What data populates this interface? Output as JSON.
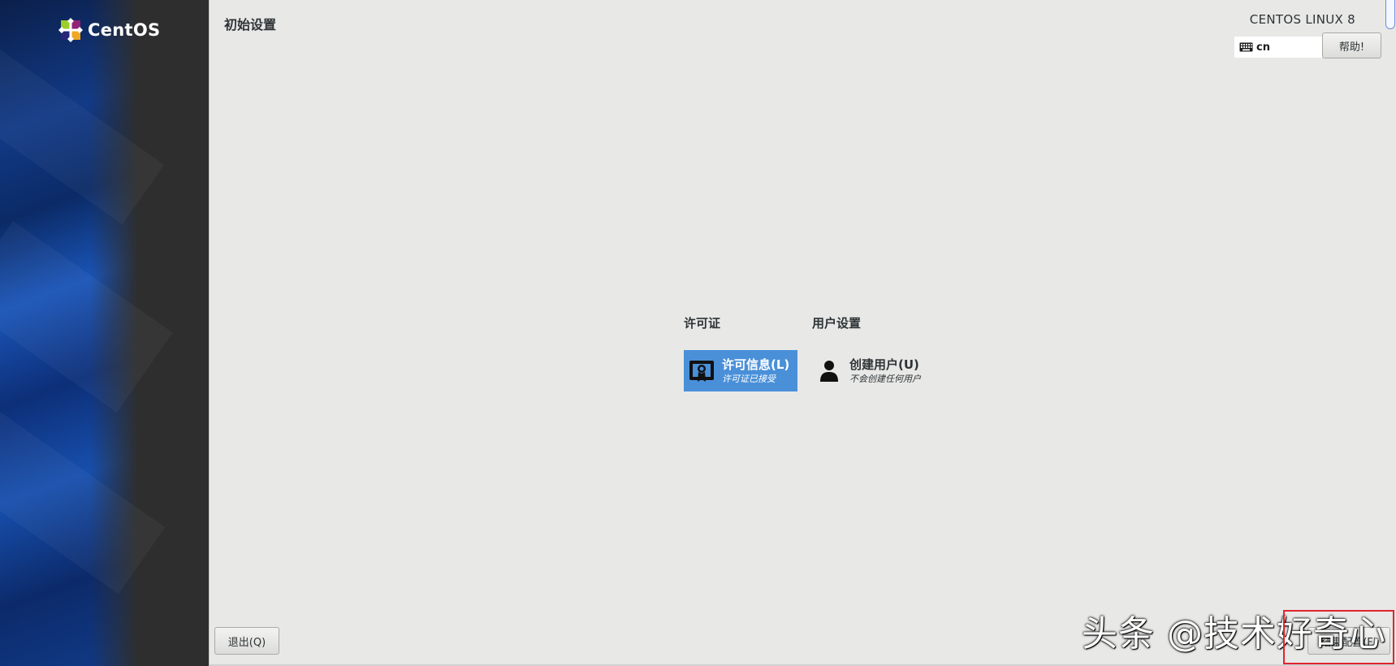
{
  "sidebar": {
    "brand": "CentOS"
  },
  "header": {
    "title": "初始设置",
    "product": "CENTOS LINUX 8",
    "keyboard_layout": "cn",
    "help_label": "帮助!"
  },
  "categories": [
    {
      "title": "许可证",
      "spokes": [
        {
          "label": "许可信息(L)",
          "status": "许可证已接受",
          "icon": "license-icon",
          "selected": true
        }
      ]
    },
    {
      "title": "用户设置",
      "spokes": [
        {
          "label": "创建用户(U)",
          "status": "不会创建任何用户",
          "icon": "user-icon",
          "selected": false
        }
      ]
    }
  ],
  "footer": {
    "quit_label": "退出(Q)",
    "finish_label": "结束配置(F)"
  },
  "overlay": {
    "watermark": "头条 @技术好奇心"
  },
  "colors": {
    "selected_spoke": "#4a90d9",
    "main_background": "#e8e8e7",
    "highlight_box": "#e0242b"
  }
}
